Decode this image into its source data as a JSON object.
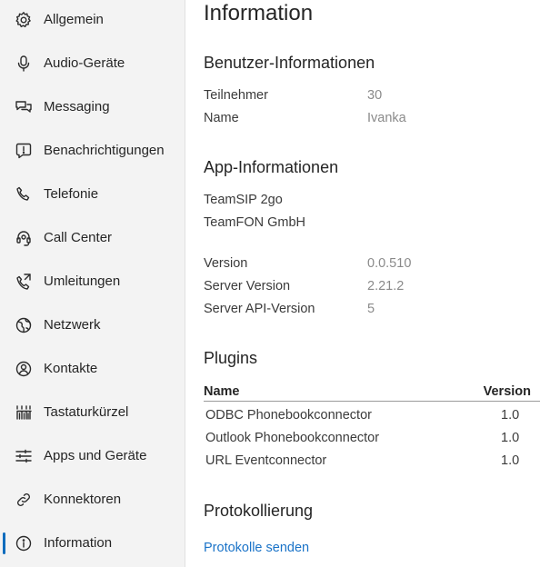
{
  "sidebar": {
    "items": [
      {
        "label": "Allgemein",
        "icon": "gear-icon"
      },
      {
        "label": "Audio-Geräte",
        "icon": "microphone-icon"
      },
      {
        "label": "Messaging",
        "icon": "chat-icon"
      },
      {
        "label": "Benachrichtigungen",
        "icon": "notification-icon"
      },
      {
        "label": "Telefonie",
        "icon": "phone-icon"
      },
      {
        "label": "Call Center",
        "icon": "headset-icon"
      },
      {
        "label": "Umleitungen",
        "icon": "call-forward-icon"
      },
      {
        "label": "Netzwerk",
        "icon": "globe-icon"
      },
      {
        "label": "Kontakte",
        "icon": "contact-icon"
      },
      {
        "label": "Tastaturkürzel",
        "icon": "keyboard-icon"
      },
      {
        "label": "Apps und Geräte",
        "icon": "sliders-icon"
      },
      {
        "label": "Konnektoren",
        "icon": "link-icon"
      },
      {
        "label": "Information",
        "icon": "info-icon",
        "active": true
      }
    ]
  },
  "main": {
    "title": "Information",
    "user_info": {
      "heading": "Benutzer-Informationen",
      "rows": [
        {
          "label": "Teilnehmer",
          "value": "30"
        },
        {
          "label": "Name",
          "value": "Ivanka"
        }
      ]
    },
    "app_info": {
      "heading": "App-Informationen",
      "product": "TeamSIP 2go",
      "company": "TeamFON GmbH",
      "rows": [
        {
          "label": "Version",
          "value": "0.0.510"
        },
        {
          "label": "Server Version",
          "value": "2.21.2"
        },
        {
          "label": "Server API-Version",
          "value": "5"
        }
      ]
    },
    "plugins": {
      "heading": "Plugins",
      "col_name": "Name",
      "col_version": "Version",
      "rows": [
        {
          "name": "ODBC Phonebookconnector",
          "version": "1.0"
        },
        {
          "name": "Outlook Phonebookconnector",
          "version": "1.0"
        },
        {
          "name": "URL Eventconnector",
          "version": "1.0"
        }
      ]
    },
    "logging": {
      "heading": "Protokollierung",
      "send_logs": "Protokolle senden"
    }
  },
  "colors": {
    "accent": "#0f6cbd",
    "link": "#1a73c8",
    "sidebar_bg": "#f3f3f3"
  }
}
